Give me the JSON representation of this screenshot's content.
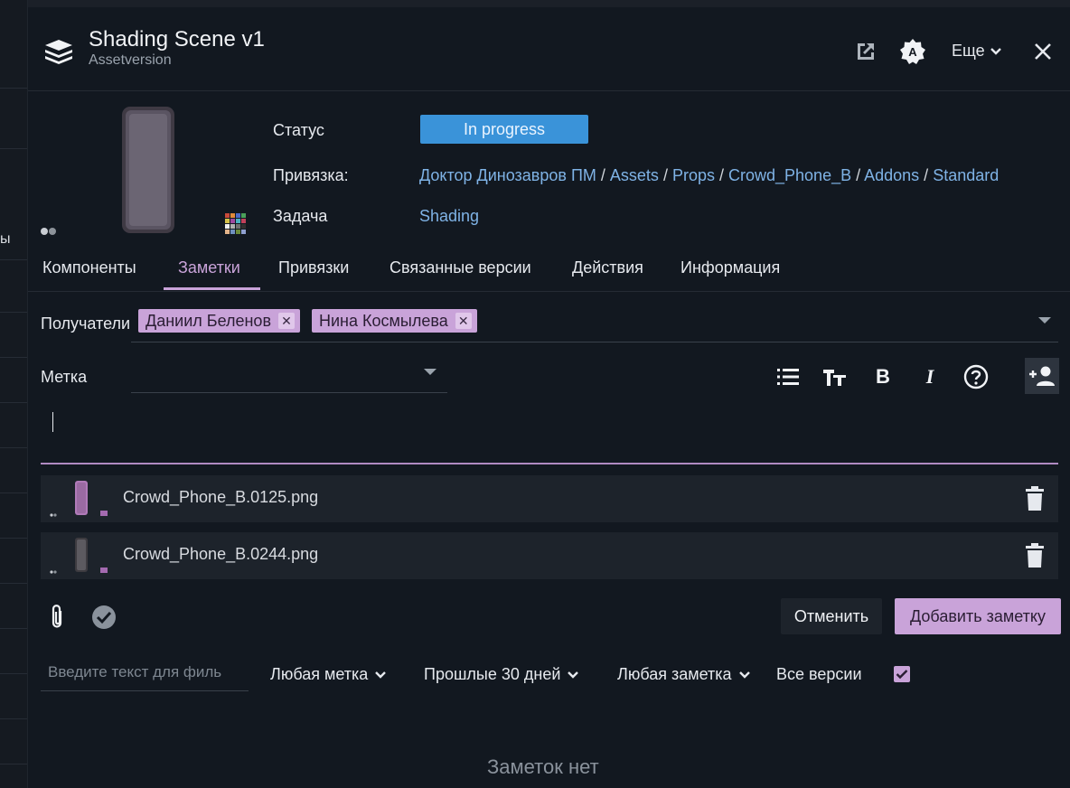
{
  "window": {
    "title": "Shading Scene v1",
    "subtitle": "Assetversion",
    "more_label": "Еще"
  },
  "left_strip": {
    "fragment": "ы"
  },
  "properties": {
    "status_label": "Статус",
    "status_value": "In progress",
    "link_label": "Привязка:",
    "breadcrumb": [
      "Доктор Динозавров ПМ",
      "Assets",
      "Props",
      "Crowd_Phone_B",
      "Addons",
      "Standard"
    ],
    "task_label": "Задача",
    "task_value": "Shading"
  },
  "tabs": [
    "Компоненты",
    "Заметки",
    "Привязки",
    "Связанные версии",
    "Действия",
    "Информация"
  ],
  "active_tab": "Заметки",
  "note_form": {
    "recipients_label": "Получатели",
    "recipients": [
      "Даниил Беленов",
      "Нина Космылева"
    ],
    "label_field_label": "Метка"
  },
  "attachments": [
    {
      "name": "Crowd_Phone_B.0125.png"
    },
    {
      "name": "Crowd_Phone_B.0244.png"
    }
  ],
  "buttons": {
    "cancel": "Отменить",
    "add_note": "Добавить заметку"
  },
  "filters": {
    "search_placeholder": "Введите текст для филь",
    "label_filter": "Любая метка",
    "date_filter": "Прошлые 30 дней",
    "note_filter": "Любая заметка",
    "all_versions": "Все версии"
  },
  "empty_state": "Заметок нет",
  "colors": {
    "accent": "#c9a3d9",
    "status": "#3a93d9",
    "link": "#7fb3e6",
    "background": "#121820"
  }
}
